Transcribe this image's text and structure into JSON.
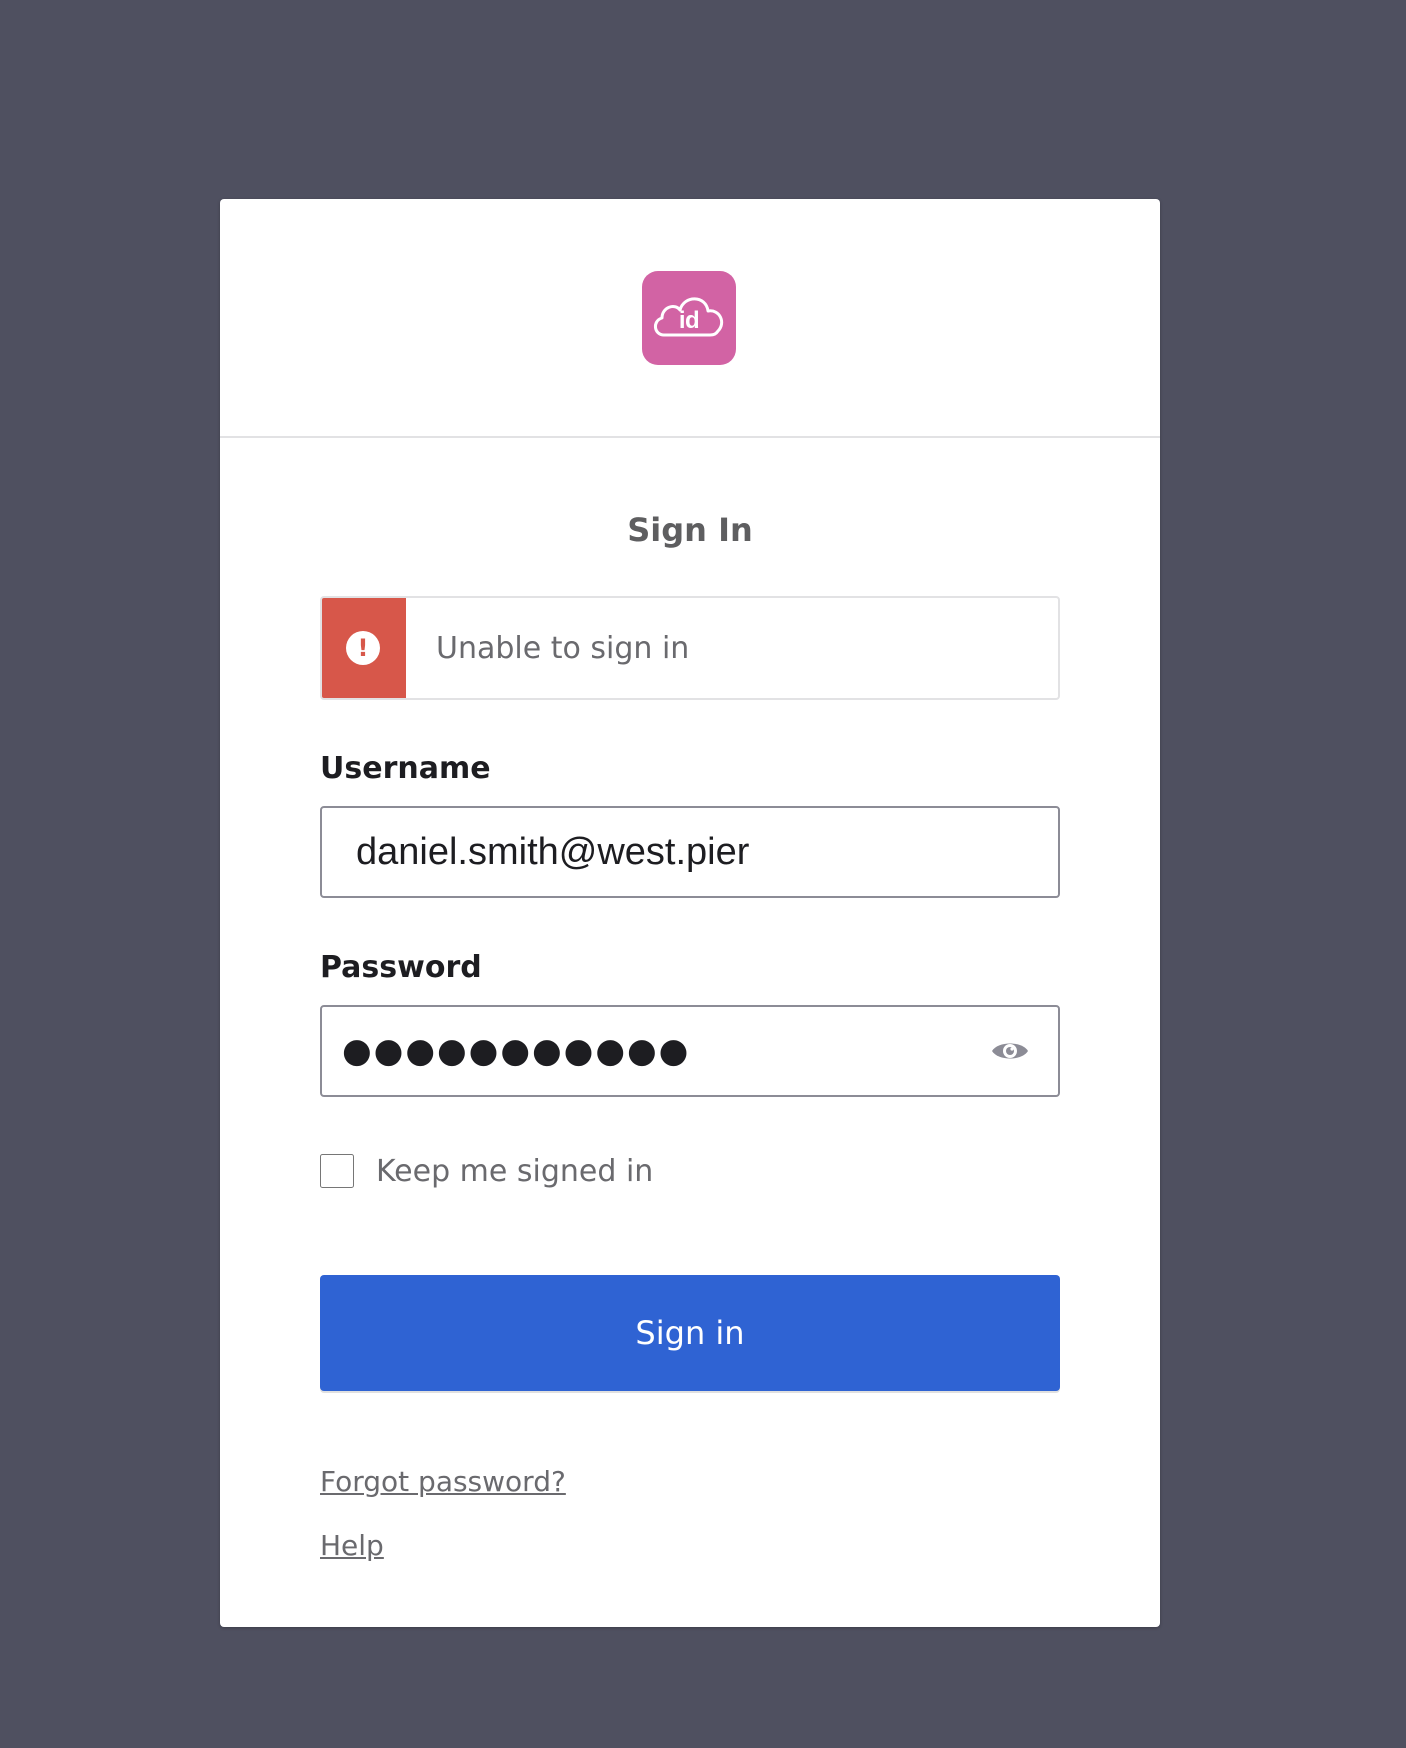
{
  "logo": {
    "text": "id",
    "icon": "cloud-id-logo",
    "color": "#d263a4"
  },
  "form": {
    "title": "Sign In",
    "error": {
      "icon": "exclamation-icon",
      "message": "Unable to sign in",
      "color": "#d7574a"
    },
    "username": {
      "label": "Username",
      "value": "daniel.smith@west.pier"
    },
    "password": {
      "label": "Password",
      "value": "●●●●●●●●●●●",
      "toggle_icon": "eye-icon"
    },
    "remember": {
      "label": "Keep me signed in",
      "checked": false
    },
    "submit": {
      "label": "Sign in",
      "color": "#2f63d3"
    },
    "links": {
      "forgot": "Forgot password?",
      "help": "Help"
    }
  }
}
